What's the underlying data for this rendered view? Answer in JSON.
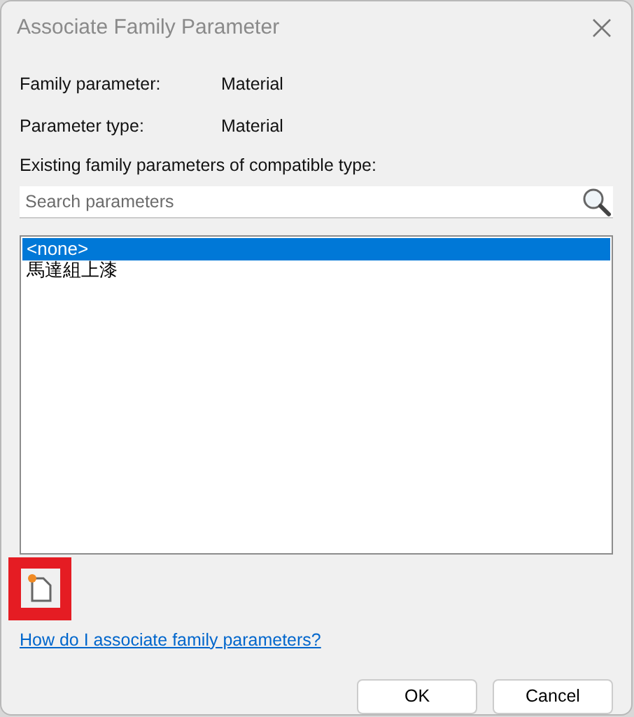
{
  "window": {
    "title": "Associate Family Parameter"
  },
  "fields": [
    {
      "label": "Family parameter:",
      "value": "Material"
    },
    {
      "label": "Parameter type:",
      "value": "Material"
    }
  ],
  "list_label": "Existing family parameters of compatible type:",
  "search": {
    "placeholder": "Search parameters"
  },
  "parameters": [
    {
      "name": "<none>",
      "selected": true
    },
    {
      "name": "馬達組上漆",
      "selected": false
    }
  ],
  "new_parameter_button": {
    "highlighted": true
  },
  "help_link": "How do I associate family parameters?",
  "buttons": [
    "OK",
    "Cancel"
  ]
}
